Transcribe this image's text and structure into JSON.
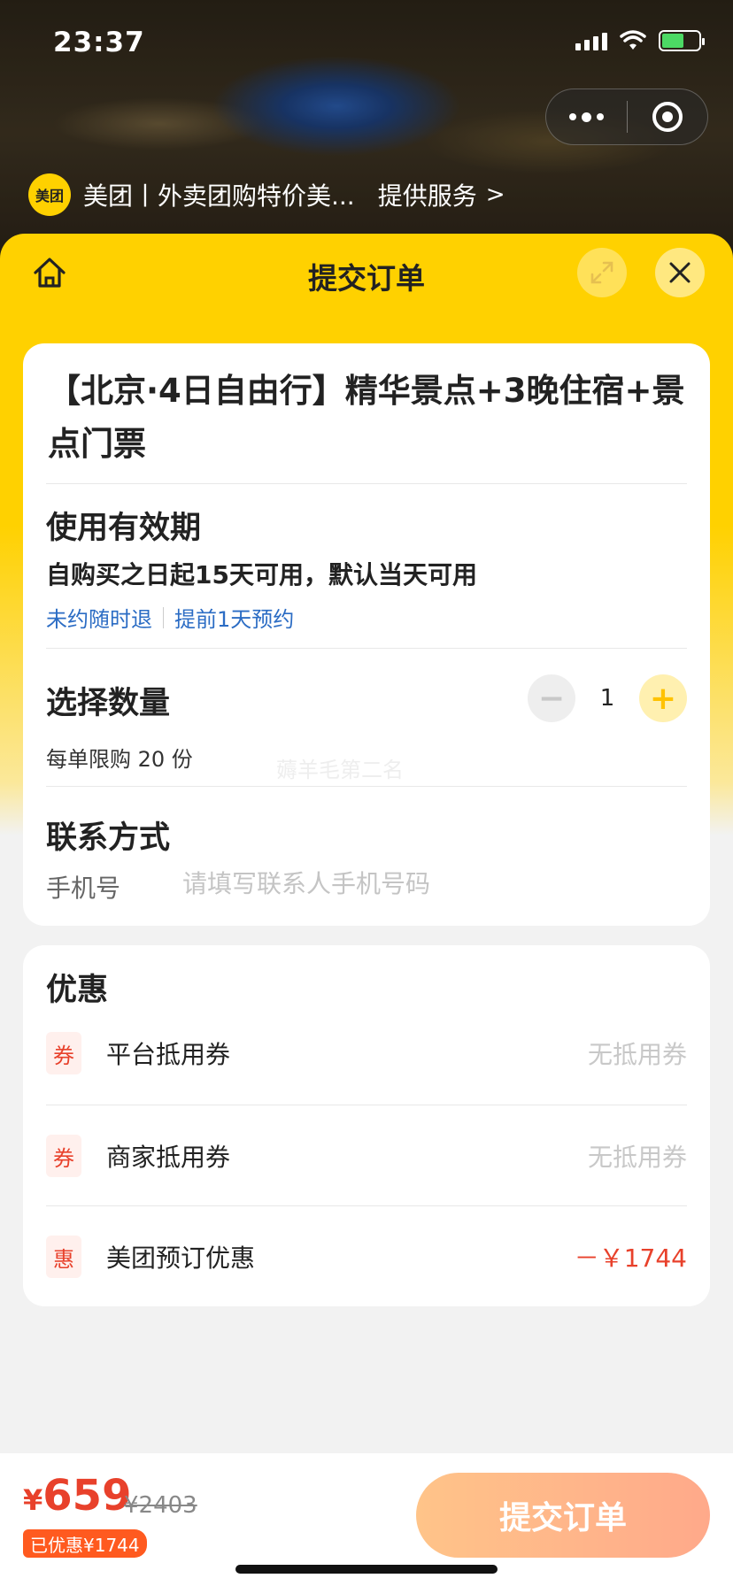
{
  "status_bar": {
    "time": "23:37"
  },
  "provider": {
    "logo_text": "美团",
    "name": "美团丨外卖团购特价美...",
    "service_label": "提供服务",
    "chevron": ">"
  },
  "sheet": {
    "title": "提交订单",
    "icons": {
      "home": "home-icon",
      "expand": "expand-icon",
      "close": "close-icon"
    }
  },
  "product": {
    "title": "【北京·4日自由行】精华景点+3晚住宿+景点门票"
  },
  "validity": {
    "section_title": "使用有效期",
    "text": "自购买之日起15天可用，默认当天可用",
    "tags": [
      "未约随时退",
      "提前1天预约"
    ]
  },
  "quantity": {
    "section_title": "选择数量",
    "minus": "−",
    "plus": "+",
    "value": "1",
    "limit_text": "每单限购 20 份",
    "watermark": "薅羊毛第二名"
  },
  "contact": {
    "section_title": "联系方式",
    "phone_label": "手机号",
    "phone_placeholder": "请填写联系人手机号码",
    "phone_value": ""
  },
  "discounts": {
    "section_title": "优惠",
    "items": [
      {
        "badge": "券",
        "label": "平台抵用券",
        "value": "无抵用券"
      },
      {
        "badge": "券",
        "label": "商家抵用券",
        "value": "无抵用券"
      },
      {
        "badge": "惠",
        "label": "美团预订优惠",
        "value": "－￥1744"
      }
    ]
  },
  "bottom_bar": {
    "currency": "¥",
    "price": "659",
    "original_price": "¥2403",
    "saved": "已优惠¥1744",
    "submit_label": "提交订单"
  },
  "colors": {
    "brand_yellow": "#ffd100",
    "price_red": "#e8412b",
    "link_blue": "#2b6cc4",
    "submit_gradient_start": "#ffc489",
    "submit_gradient_end": "#ffa98a"
  }
}
